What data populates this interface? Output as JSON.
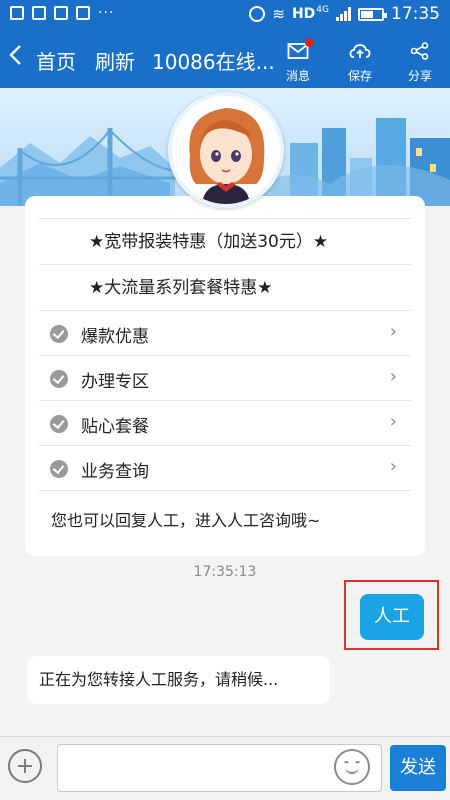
{
  "status_bar": {
    "network": "HD",
    "network_gen": "4G",
    "time": "17:35"
  },
  "nav": {
    "back_icon": "chevron-left-icon",
    "home_label": "首页",
    "refresh_label": "刷新",
    "title": "10086在线...",
    "actions": [
      {
        "label": "消息",
        "icon": "mail-icon",
        "has_badge": true
      },
      {
        "label": "保存",
        "icon": "cloud-upload-icon"
      },
      {
        "label": "分享",
        "icon": "share-icon"
      }
    ]
  },
  "card": {
    "promos": [
      "★宽带报装特惠（加送30元）★",
      "★大流量系列套餐特惠★"
    ],
    "menu_items": [
      {
        "label": "爆款优惠"
      },
      {
        "label": "办理专区"
      },
      {
        "label": "贴心套餐"
      },
      {
        "label": "业务查询"
      }
    ],
    "footer": "您也可以回复人工，进入人工咨询哦~"
  },
  "chat": {
    "timestamp": "17:35:13",
    "outgoing": "人工",
    "incoming": "正在为您转接人工服务，请稍候..."
  },
  "input_bar": {
    "send_label": "发送"
  },
  "colors": {
    "primary": "#1a6fc9",
    "bubble_out": "#1aa3e5",
    "highlight": "#d8342c"
  }
}
